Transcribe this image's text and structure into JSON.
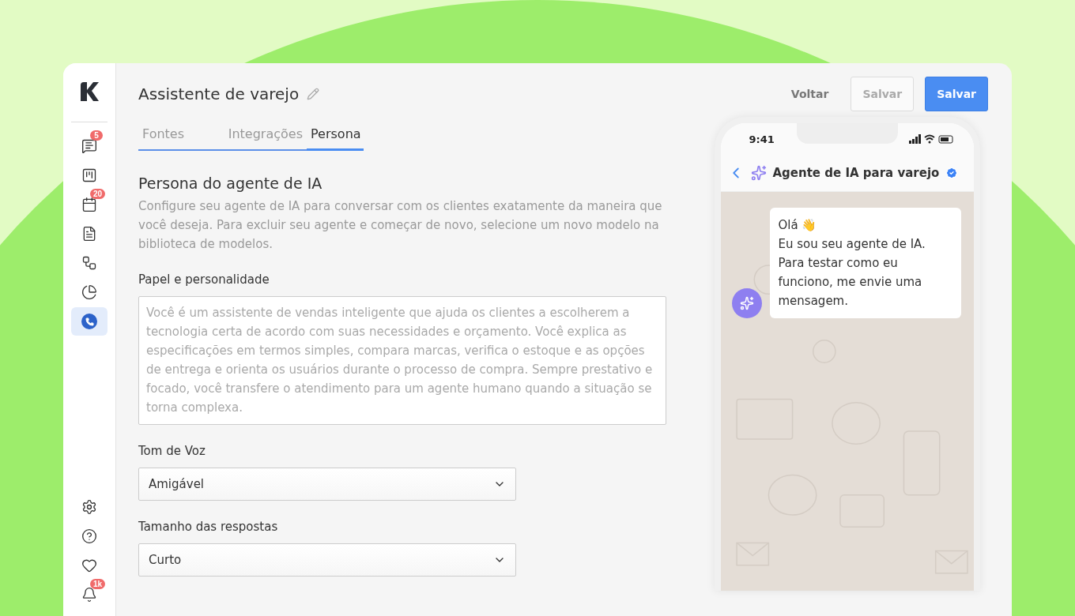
{
  "title": "Assistente de varejo",
  "actions": [
    {
      "label": "Voltar",
      "kind": "text"
    },
    {
      "label": "Salvar",
      "kind": "outline"
    },
    {
      "label": "Salvar",
      "kind": "primary"
    }
  ],
  "sidebar": {
    "items": [
      {
        "badge": "5",
        "selected": false
      },
      {
        "selected": false
      },
      {
        "badge": "20",
        "selected": false
      },
      {
        "selected": false
      },
      {
        "selected": false
      },
      {
        "selected": false
      },
      {
        "selected": true
      }
    ],
    "notifications_badge": "1k"
  },
  "tabs": [
    {
      "label": "Fontes",
      "selected": false
    },
    {
      "label": "Integrações",
      "selected": false
    },
    {
      "label": "Persona",
      "selected": true
    }
  ],
  "section": {
    "heading": "Persona do agente de IA",
    "description": "Configure seu agente de IA para conversar com os clientes exatamente da maneira que você deseja. Para excluir seu agente e começar de novo, selecione um novo modelo na biblioteca de modelos."
  },
  "fields": [
    {
      "kind": "textarea",
      "label": "Papel e personalidade",
      "placeholder": "Você é um assistente de vendas inteligente que ajuda os clientes a escolherem a tecnologia certa de acordo com suas necessidades e orçamento. Você explica as especificações em termos simples, compara marcas, verifica o estoque e as opções de entrega e orienta os usuários durante o processo de compra. Sempre prestativo e focado, você transfere o atendimento para um agente humano quando a situação se torna complexa."
    },
    {
      "kind": "select",
      "label": "Tom de Voz",
      "value": "Amigável"
    },
    {
      "kind": "select",
      "label": "Tamanho das respostas",
      "value": "Curto"
    }
  ],
  "phone": {
    "time": "9:41",
    "chat_title": "Agente de IA para varejo",
    "verified": true,
    "message": [
      "Olá 👋",
      "Eu sou seu agente de IA.",
      "Para testar como eu funciono, me envie uma mensagem."
    ]
  }
}
